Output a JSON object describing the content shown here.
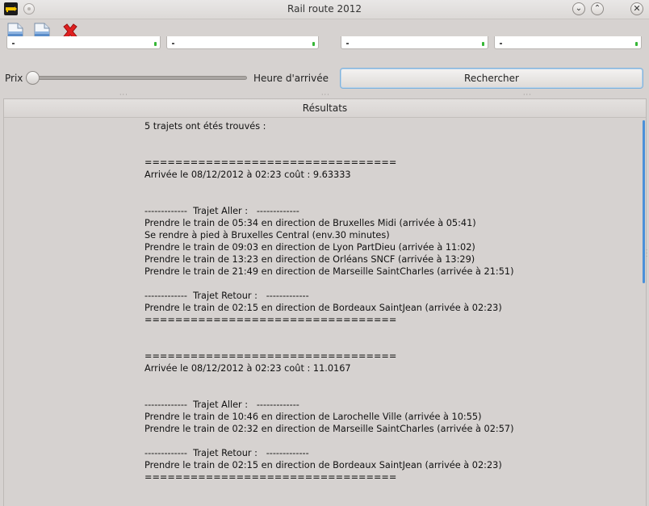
{
  "window": {
    "title": "Rail route 2012",
    "minimize_glyph": "⌄",
    "maximize_glyph": "⌃",
    "close_glyph": "✕"
  },
  "toolbar": {
    "icons": [
      "new-document-icon",
      "open-document-icon",
      "quit-red-x-icon"
    ]
  },
  "filters": {
    "price_label": "Prix",
    "price_slider_fraction": 0,
    "arrival_label": "Heure d'arrivée",
    "search_label": "Rechercher"
  },
  "results": {
    "header": "Résultats",
    "lines": [
      "5 trajets ont étés trouvés :",
      "",
      "",
      "=================================",
      "Arrivée le 08/12/2012 à 02:23 coût : 9.63333",
      "",
      "",
      "-------------  Trajet Aller :   -------------",
      "Prendre le train de 05:34 en direction de Bruxelles Midi (arrivée à 05:41)",
      "Se rendre à pied à Bruxelles Central (env.30 minutes)",
      "Prendre le train de 09:03 en direction de Lyon PartDieu (arrivée à 11:02)",
      "Prendre le train de 13:23 en direction de Orléans SNCF (arrivée à 13:29)",
      "Prendre le train de 21:49 en direction de Marseille SaintCharles (arrivée à 21:51)",
      "",
      "-------------  Trajet Retour :   -------------",
      "Prendre le train de 02:15 en direction de Bordeaux SaintJean (arrivée à 02:23)",
      "=================================",
      "",
      "",
      "=================================",
      "Arrivée le 08/12/2012 à 02:23 coût : 11.0167",
      "",
      "",
      "-------------  Trajet Aller :   -------------",
      "Prendre le train de 10:46 en direction de Larochelle Ville (arrivée à 10:55)",
      "Prendre le train de 02:32 en direction de Marseille SaintCharles (arrivée à 02:57)",
      "",
      "-------------  Trajet Retour :   -------------",
      "Prendre le train de 02:15 en direction de Bordeaux SaintJean (arrivée à 02:23)",
      "================================="
    ]
  },
  "colors": {
    "accent": "#4a90d9",
    "quit_icon": "#e02020",
    "field_status": "#36b736"
  }
}
